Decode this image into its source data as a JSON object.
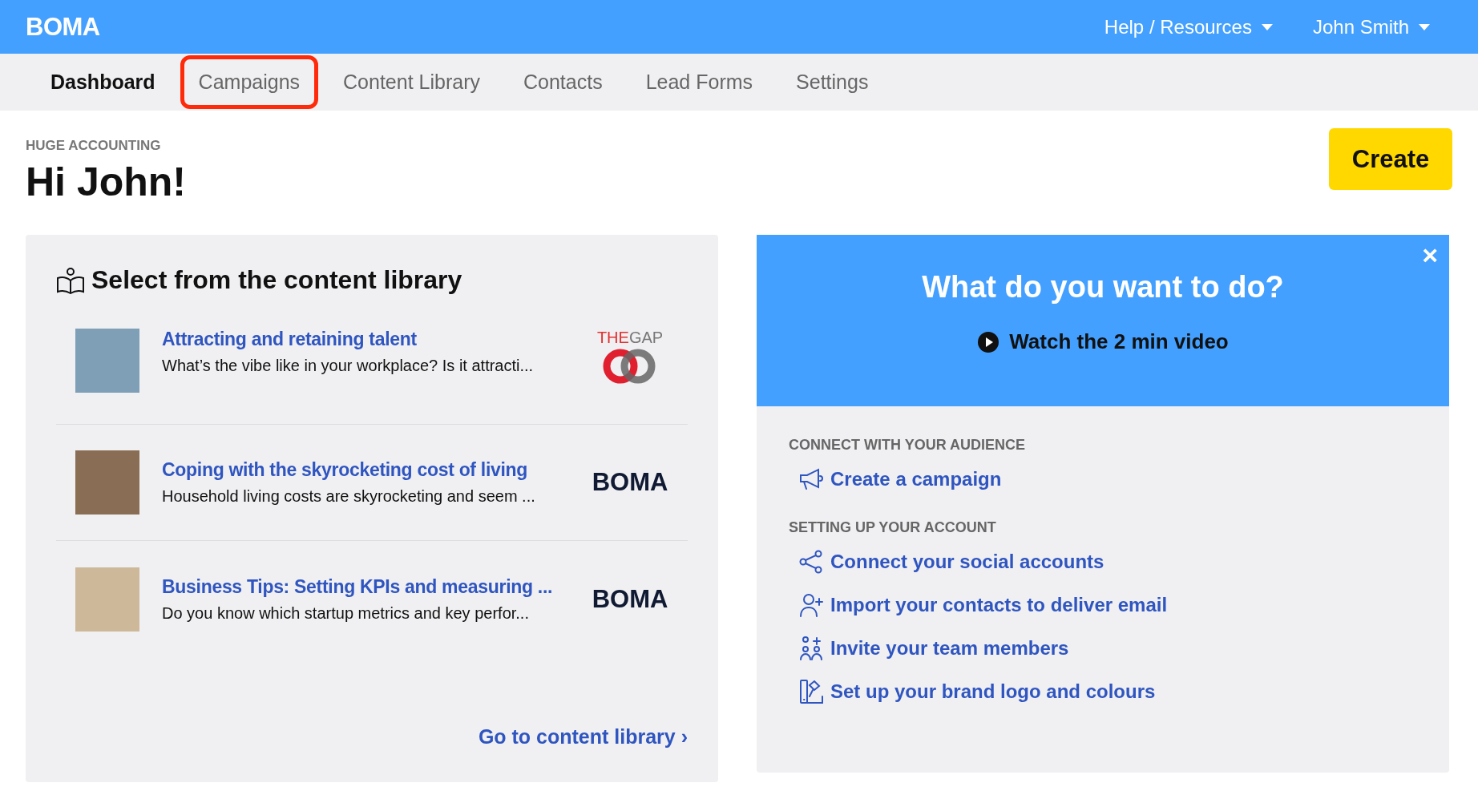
{
  "header": {
    "logo": "BOMA",
    "menus": [
      {
        "label": "Help / Resources"
      },
      {
        "label": "John Smith"
      }
    ]
  },
  "nav": [
    {
      "label": "Dashboard",
      "selected": true,
      "highlighted": false
    },
    {
      "label": "Campaigns",
      "selected": false,
      "highlighted": true
    },
    {
      "label": "Content Library",
      "selected": false,
      "highlighted": false
    },
    {
      "label": "Contacts",
      "selected": false,
      "highlighted": false
    },
    {
      "label": "Lead Forms",
      "selected": false,
      "highlighted": false
    },
    {
      "label": "Settings",
      "selected": false,
      "highlighted": false
    }
  ],
  "page": {
    "company": "HUGE ACCOUNTING",
    "greeting": "Hi John!",
    "create_button": "Create"
  },
  "library": {
    "title": "Select from the content library",
    "items": [
      {
        "title": "Attracting and retaining talent",
        "description": "What’s the vibe like in your workplace? Is it attracti...",
        "source": {
          "kind": "thegap",
          "parts": [
            "THE",
            "GAP"
          ]
        }
      },
      {
        "title": "Coping with the skyrocketing cost of living",
        "description": "Household living costs are skyrocketing and seem ...",
        "source": {
          "kind": "boma",
          "parts": [
            "BOMA"
          ]
        }
      },
      {
        "title": "Business Tips: Setting KPIs and measuring ...",
        "description": "Do you know which startup metrics and key perfor...",
        "source": {
          "kind": "boma",
          "parts": [
            "BOMA"
          ]
        }
      }
    ],
    "link": "Go to content library ›"
  },
  "actions": {
    "title": "What do you want to do?",
    "video": "Watch the 2 min video",
    "close": "×",
    "sections": [
      {
        "heading": "CONNECT WITH YOUR AUDIENCE",
        "links": [
          {
            "kind": "megaphone",
            "label": "Create a campaign"
          }
        ]
      },
      {
        "heading": "SETTING UP YOUR ACCOUNT",
        "links": [
          {
            "kind": "share",
            "label": "Connect your social accounts"
          },
          {
            "kind": "add-person",
            "label": "Import your contacts to deliver email"
          },
          {
            "kind": "team",
            "label": "Invite your team members"
          },
          {
            "kind": "brand",
            "label": "Set up your brand logo and colours"
          }
        ]
      }
    ]
  }
}
